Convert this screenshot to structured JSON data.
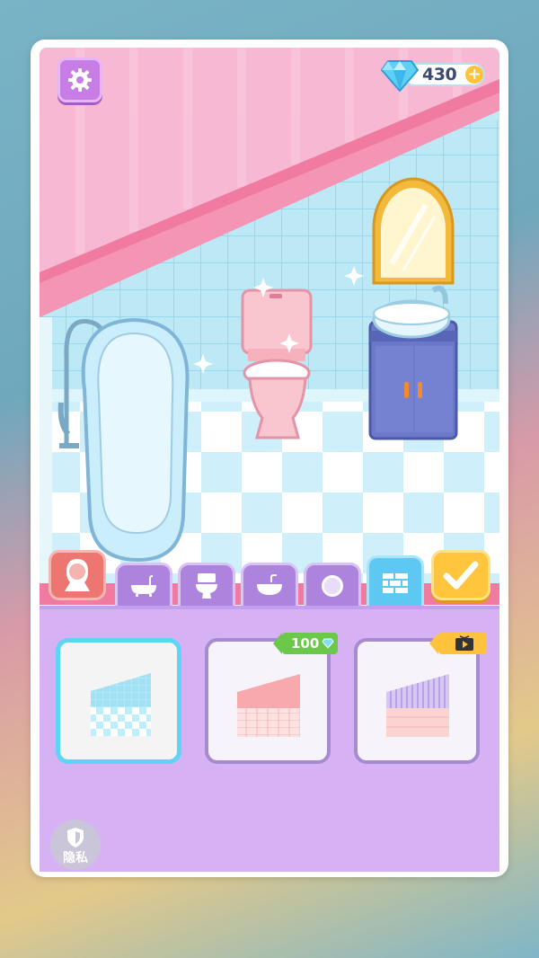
{
  "header": {
    "gem_count": "430",
    "gem_plus": "+"
  },
  "tabs": [
    {
      "name": "avatar",
      "icon": "girl-silhouette-icon"
    },
    {
      "name": "bathtub",
      "icon": "bathtub-icon"
    },
    {
      "name": "toilet",
      "icon": "toilet-icon"
    },
    {
      "name": "sink",
      "icon": "sink-icon"
    },
    {
      "name": "mirror",
      "icon": "mirror-icon"
    },
    {
      "name": "wall",
      "icon": "brick-wall-icon",
      "active": true
    },
    {
      "name": "confirm",
      "icon": "checkmark-icon"
    }
  ],
  "wall_options": [
    {
      "selected": true,
      "price": null,
      "lock": null
    },
    {
      "selected": false,
      "price": "100",
      "lock": "gems"
    },
    {
      "selected": false,
      "price": null,
      "lock": "video-ad"
    }
  ],
  "privacy": {
    "label": "隐私",
    "icon": "shield-icon"
  },
  "colors": {
    "wall_top": "#f8b8d6",
    "tile": "#bde9f6",
    "accent_purple": "#d6b2f4",
    "active_tab": "#5dc8f2",
    "confirm": "#ffc53c"
  }
}
